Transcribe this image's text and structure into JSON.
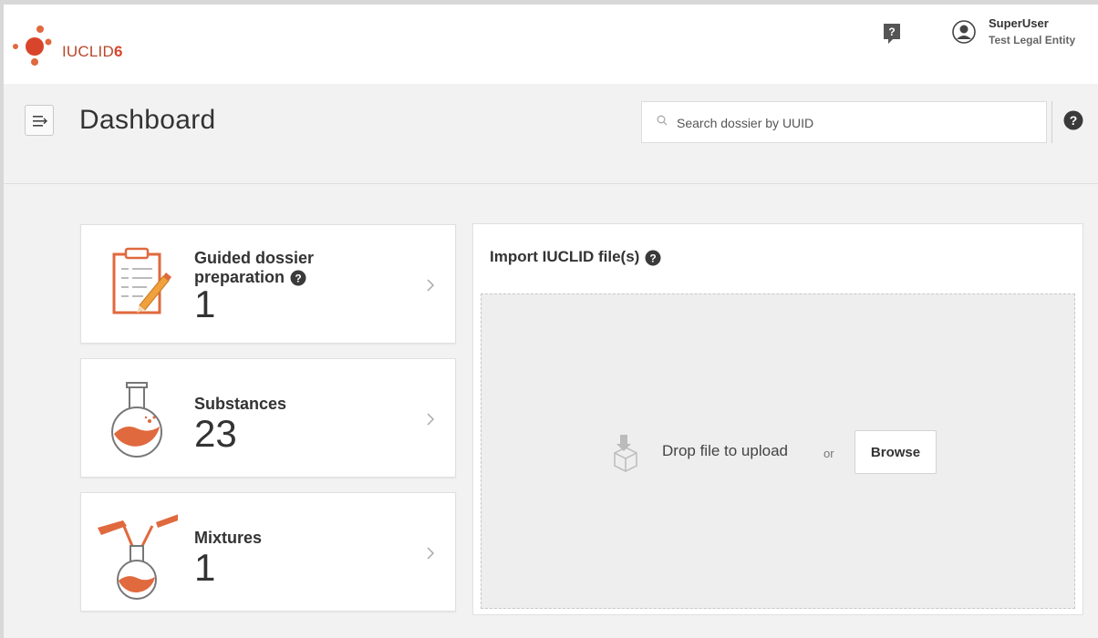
{
  "app": {
    "logo_text": "IUCLID",
    "logo_version": "6",
    "brand_color": "#c9522e"
  },
  "topbar": {
    "feedback_icon": "feedback-question-icon",
    "user": {
      "name": "SuperUser",
      "legal_entity": "Test Legal Entity"
    }
  },
  "header": {
    "title": "Dashboard",
    "search_placeholder": "Search dossier by UUID",
    "search_value": ""
  },
  "cards": [
    {
      "label_line1": "Guided dossier",
      "label_line2": "preparation",
      "count": "1",
      "icon": "clipboard-pencil-icon"
    },
    {
      "label": "Substances",
      "count": "23",
      "icon": "flask-icon"
    },
    {
      "label": "Mixtures",
      "count": "1",
      "icon": "mixing-flasks-icon"
    }
  ],
  "import": {
    "title": "Import IUCLID file(s)",
    "drop_text": "Drop file to upload",
    "or_text": "or",
    "browse_label": "Browse"
  },
  "colors": {
    "accent_orange": "#e0693e",
    "background": "#f2f2f2"
  }
}
